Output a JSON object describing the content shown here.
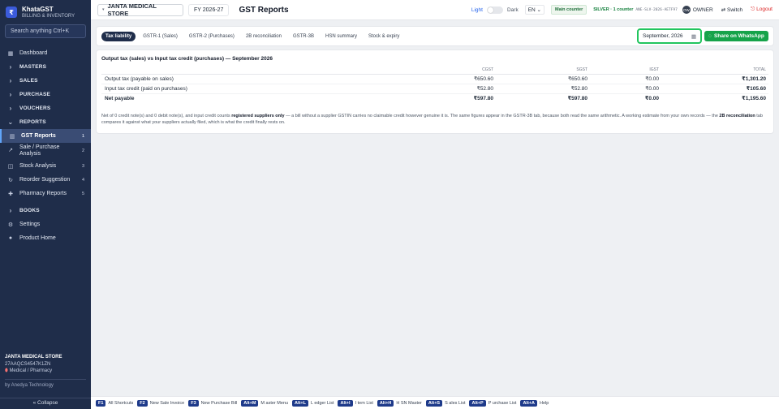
{
  "brand": {
    "name": "KhataGST",
    "subtitle": "BILLING & INVENTORY",
    "logo": "₹"
  },
  "sidebar": {
    "search_placeholder": "Search anything  Ctrl+K",
    "items": [
      {
        "label": "Dashboard",
        "icon": "grid-icon"
      },
      {
        "label": "MASTERS",
        "section": true
      },
      {
        "label": "SALES",
        "section": true
      },
      {
        "label": "PURCHASE",
        "section": true
      },
      {
        "label": "VOUCHERS",
        "section": true
      },
      {
        "label": "REPORTS",
        "section": true,
        "expanded": true
      },
      {
        "label": "GST Reports",
        "badge": "1",
        "active": true
      },
      {
        "label": "Sale / Purchase Analysis",
        "badge": "2"
      },
      {
        "label": "Stock Analysis",
        "badge": "3"
      },
      {
        "label": "Reorder Suggestion",
        "badge": "4"
      },
      {
        "label": "Pharmacy Reports",
        "badge": "5"
      },
      {
        "label": "BOOKS",
        "section": true
      },
      {
        "label": "Settings",
        "icon": "gear-icon"
      },
      {
        "label": "Product Home",
        "icon": "user-icon"
      }
    ],
    "store_name": "JANTA MEDICAL STORE",
    "store_gstin": "27AAQCS4547K1ZN",
    "store_type": "Medical / Pharmacy",
    "by_line": "by Anedya Technology",
    "collapse_label": "« Collapse"
  },
  "header": {
    "store": "JANTA MEDICAL STORE",
    "fy": "FY 2026-27",
    "title": "GST Reports",
    "theme_light": "Light",
    "theme_dark": "Dark",
    "lang": "EN",
    "counter": "Main counter",
    "license": "SILVER · 1 counter",
    "license_code": "ANE-SLV-2026-AETF97",
    "avatar": "OW",
    "role": "OWNER",
    "switch": "⇄ Switch",
    "logout": "⎋ Logout"
  },
  "tabs": [
    "Tax liability",
    "GSTR-1 (Sales)",
    "GSTR-2 (Purchases)",
    "2B reconciliation",
    "GSTR-3B",
    "HSN summary",
    "Stock & expiry"
  ],
  "active_tab": 0,
  "period": {
    "value": "September, 2026"
  },
  "whatsapp_label": "Share on WhatsApp",
  "report": {
    "title": "Output tax (sales) vs Input tax credit (purchases) — September 2026",
    "columns": [
      "",
      "CGST",
      "SGST",
      "IGST",
      "TOTAL"
    ],
    "rows": [
      [
        "Output tax (payable on sales)",
        "₹650.60",
        "₹650.60",
        "₹0.00",
        "₹1,301.20"
      ],
      [
        "Input tax credit (paid on purchases)",
        "₹52.80",
        "₹52.80",
        "₹0.00",
        "₹105.60"
      ]
    ],
    "total": [
      "Net payable",
      "₹597.80",
      "₹597.80",
      "₹0.00",
      "₹1,195.60"
    ],
    "note_1": "Net of 0 credit note(s) and 0 debit note(s), and input credit counts ",
    "note_bold_1": "registered suppliers only",
    "note_2": " — a bill without a supplier GSTIN carries no claimable credit however genuine it is. The same figures appear in the GSTR-3B tab, because both read the same arithmetic. A working estimate from your own records — the ",
    "note_bold_2": "2B reconciliation",
    "note_3": " tab compares it against what your suppliers actually filed, which is what the credit finally rests on."
  },
  "shortcuts": [
    {
      "key": "F1",
      "label": "All Shortcuts"
    },
    {
      "key": "F2",
      "label": "New Sale Invoice"
    },
    {
      "key": "F3",
      "label": "New Purchase Bill"
    },
    {
      "key": "Alt+M",
      "label": "M aster Menu"
    },
    {
      "key": "Alt+L",
      "label": "L edger List"
    },
    {
      "key": "Alt+I",
      "label": "I tem List"
    },
    {
      "key": "Alt+H",
      "label": "H SN Master"
    },
    {
      "key": "Alt+S",
      "label": "S ales List"
    },
    {
      "key": "Alt+P",
      "label": "P urchase List"
    },
    {
      "key": "Alt+A",
      "label": "Help"
    }
  ]
}
